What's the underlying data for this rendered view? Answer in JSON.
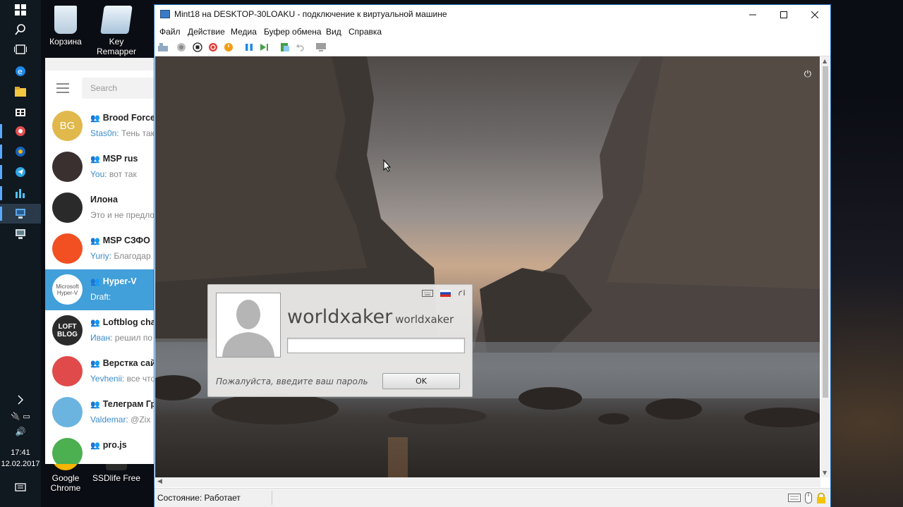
{
  "desktop": {
    "icons": [
      {
        "label": "Корзина"
      },
      {
        "label": "Key Remapper"
      },
      {
        "label": "Google Chrome"
      },
      {
        "label": "SSDlife Free"
      }
    ],
    "clock": {
      "time": "17:41",
      "date": "12.02.2017"
    }
  },
  "telegram": {
    "search_placeholder": "Search",
    "chats": [
      {
        "title": "Brood Force",
        "sender": "Stas0n:",
        "message": " Тень так",
        "avatar_text": "BG",
        "avatar_color": "#e0b84b",
        "group": true
      },
      {
        "title": "MSP rus",
        "sender": "You:",
        "message": " вот так",
        "avatar_text": "",
        "avatar_color": "#3a3030",
        "group": true
      },
      {
        "title": "Илона",
        "sender": "",
        "message": "Это и не предло",
        "avatar_text": "",
        "avatar_color": "#2a2a2a",
        "group": false
      },
      {
        "title": "MSP СЗФО",
        "sender": "Yuriy:",
        "message": " Благодар",
        "avatar_text": "",
        "avatar_color": "#f25022",
        "group": true
      },
      {
        "title": "Hyper-V",
        "sender": "",
        "message": "Draft:",
        "avatar_text": "Microsoft Hyper-V",
        "avatar_color": "#ffffff",
        "group": true,
        "selected": true
      },
      {
        "title": "Loftblog cha",
        "sender": "Иван:",
        "message": " решил по",
        "avatar_text": "LOFT BLOG",
        "avatar_color": "#2b2b2b",
        "group": true
      },
      {
        "title": "Верстка сай",
        "sender": "Yevhenii:",
        "message": " все что",
        "avatar_text": "",
        "avatar_color": "#e04a4a",
        "group": true
      },
      {
        "title": "Телеграм Гр",
        "sender": "Valdemar:",
        "message": " @Zix",
        "avatar_text": "",
        "avatar_color": "#6cb4e0",
        "group": true
      },
      {
        "title": "pro.js",
        "sender": "",
        "message": "",
        "avatar_text": "",
        "avatar_color": "#4caf50",
        "group": true
      }
    ]
  },
  "vm": {
    "title": "Mint18 на DESKTOP-30LOAKU - подключение к виртуальной машине",
    "menu": [
      "Файл",
      "Действие",
      "Медиа",
      "Буфер обмена",
      "Вид",
      "Справка"
    ],
    "status": "Состояние: Работает",
    "login": {
      "name_large": "worldxaker",
      "name_small": "worldxaker",
      "prompt": "Пожалуйста, введите ваш пароль",
      "ok_label": "OK",
      "password_value": ""
    }
  }
}
